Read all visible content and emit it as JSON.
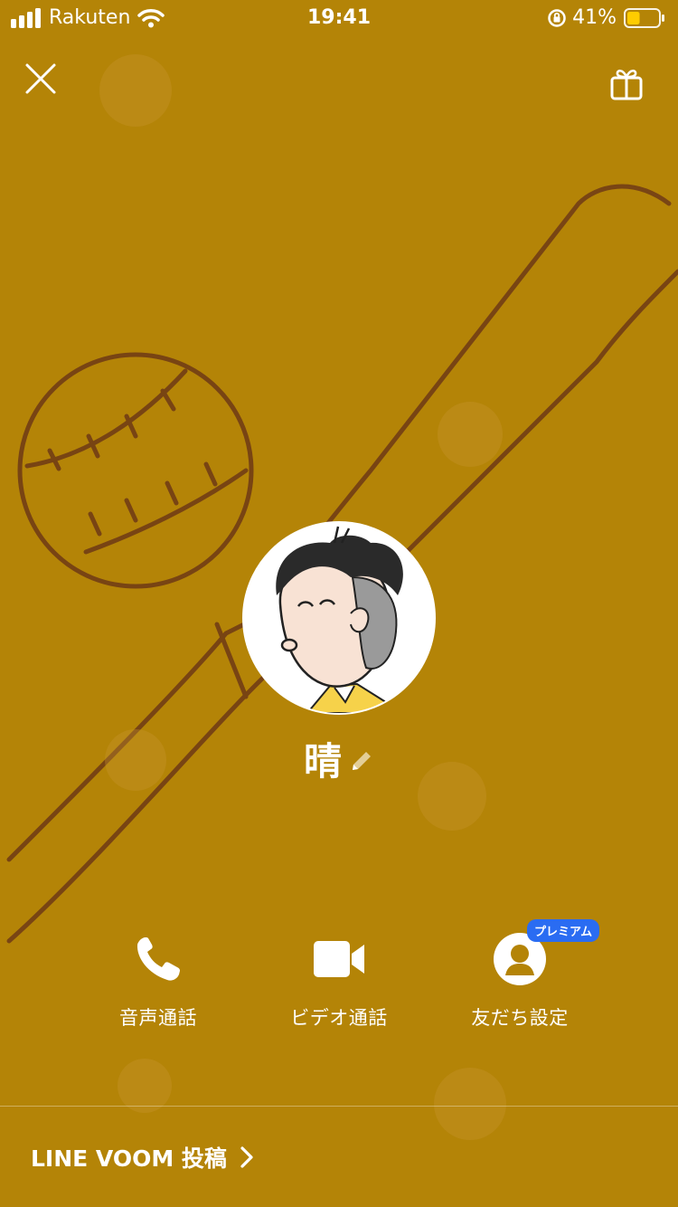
{
  "status_bar": {
    "carrier": "Rakuten",
    "time": "19:41",
    "battery_percent": "41%",
    "battery_level": 0.41,
    "battery_color": "#FFCC00"
  },
  "header": {
    "close_icon": "close-icon",
    "gift_icon": "gift-icon"
  },
  "profile": {
    "name": "晴",
    "background_color": "#B48407"
  },
  "actions": [
    {
      "label": "音声通話",
      "icon": "phone-icon"
    },
    {
      "label": "ビデオ通話",
      "icon": "video-camera-icon"
    },
    {
      "label": "友だち設定",
      "icon": "person-icon",
      "badge": "プレミアム"
    }
  ],
  "badge_color": "#2A6CF2",
  "footer": {
    "voom_label": "LINE VOOM 投稿"
  }
}
